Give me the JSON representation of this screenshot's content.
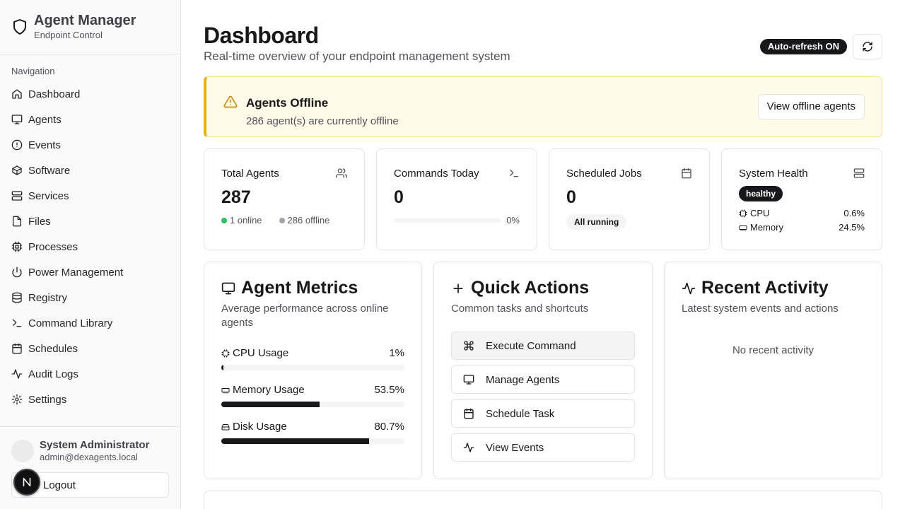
{
  "sidebar": {
    "brand_title": "Agent Manager",
    "brand_subtitle": "Endpoint Control",
    "nav_label": "Navigation",
    "items": [
      {
        "label": "Dashboard",
        "icon": "home-icon"
      },
      {
        "label": "Agents",
        "icon": "monitor-icon"
      },
      {
        "label": "Events",
        "icon": "alert-circle-icon"
      },
      {
        "label": "Software",
        "icon": "package-icon"
      },
      {
        "label": "Services",
        "icon": "server-icon"
      },
      {
        "label": "Files",
        "icon": "file-icon"
      },
      {
        "label": "Processes",
        "icon": "cpu-icon"
      },
      {
        "label": "Power Management",
        "icon": "power-icon"
      },
      {
        "label": "Registry",
        "icon": "database-icon"
      },
      {
        "label": "Command Library",
        "icon": "terminal-icon"
      },
      {
        "label": "Schedules",
        "icon": "calendar-icon"
      },
      {
        "label": "Audit Logs",
        "icon": "activity-icon"
      },
      {
        "label": "Settings",
        "icon": "settings-icon"
      }
    ],
    "user": {
      "name": "System Administrator",
      "email": "admin@dexagents.local"
    },
    "logout_label": "Logout"
  },
  "header": {
    "title": "Dashboard",
    "subtitle": "Real-time overview of your endpoint management system",
    "auto_refresh": "Auto-refresh ON"
  },
  "alert": {
    "title": "Agents Offline",
    "description": "286 agent(s) are currently offline",
    "button": "View offline agents"
  },
  "stats": {
    "total_agents": {
      "title": "Total Agents",
      "value": "287",
      "online": "1 online",
      "offline": "286 offline"
    },
    "commands_today": {
      "title": "Commands Today",
      "value": "0",
      "percent": "0%",
      "progress": 0
    },
    "scheduled_jobs": {
      "title": "Scheduled Jobs",
      "value": "0",
      "status": "All running"
    },
    "system_health": {
      "title": "System Health",
      "status": "healthy",
      "cpu_label": "CPU",
      "cpu_value": "0.6%",
      "memory_label": "Memory",
      "memory_value": "24.5%"
    }
  },
  "metrics": {
    "title": "Agent Metrics",
    "subtitle": "Average performance across online agents",
    "cpu": {
      "label": "CPU Usage",
      "value": "1%",
      "fraction": 0.01
    },
    "memory": {
      "label": "Memory Usage",
      "value": "53.5%",
      "fraction": 0.535
    },
    "disk": {
      "label": "Disk Usage",
      "value": "80.7%",
      "fraction": 0.807
    }
  },
  "quick_actions": {
    "title": "Quick Actions",
    "subtitle": "Common tasks and shortcuts",
    "items": [
      "Execute Command",
      "Manage Agents",
      "Schedule Task",
      "View Events"
    ]
  },
  "recent_activity": {
    "title": "Recent Activity",
    "subtitle": "Latest system events and actions",
    "empty": "No recent activity"
  },
  "colors": {
    "online": "#22c55e",
    "offline": "#a1a1aa",
    "warning": "#eab308",
    "primary": "#18181b"
  }
}
